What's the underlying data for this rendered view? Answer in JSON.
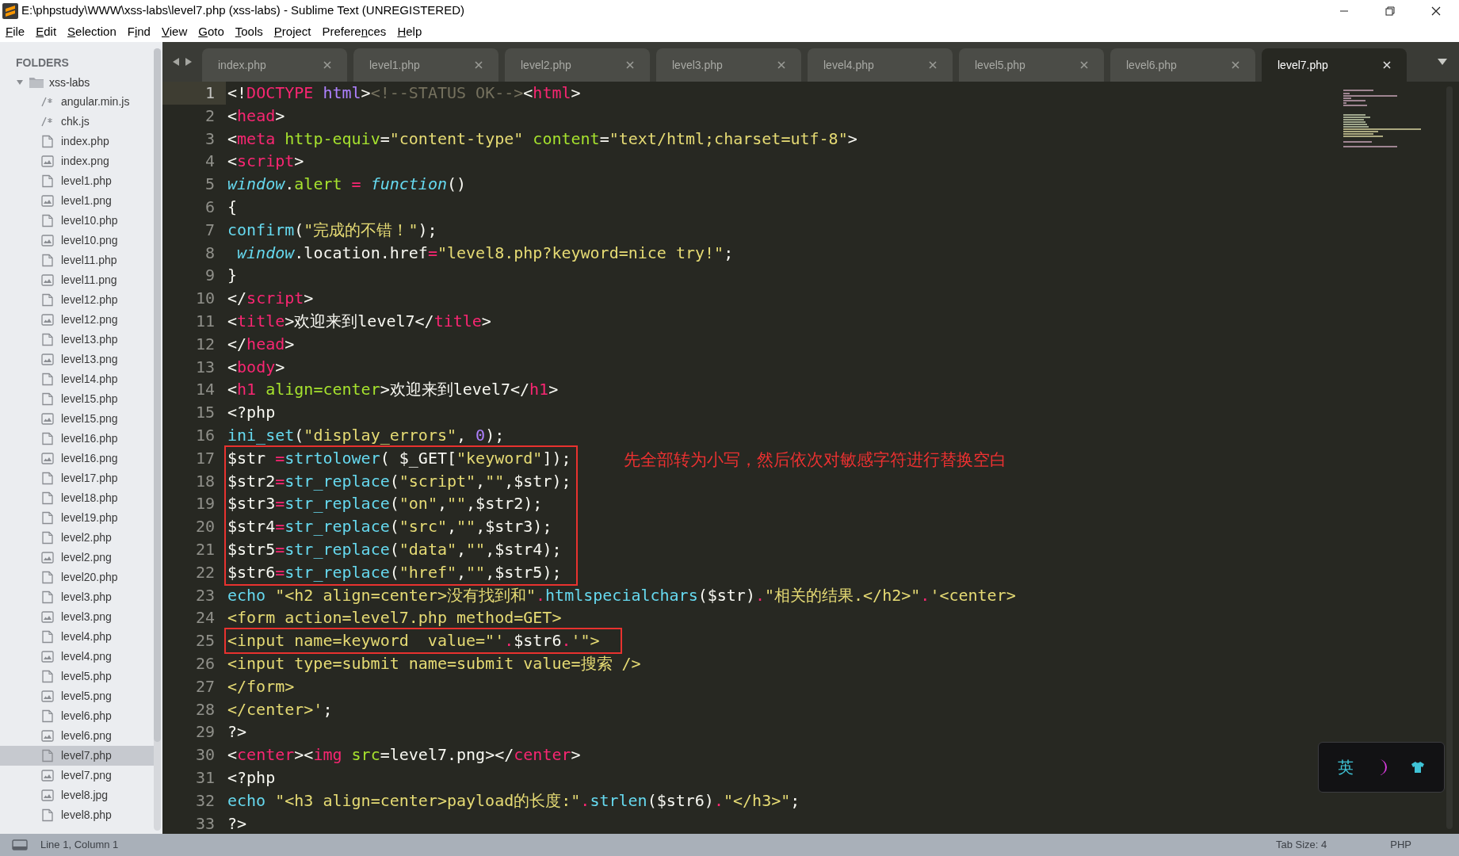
{
  "window": {
    "title": "E:\\phpstudy\\WWW\\xss-labs\\level7.php (xss-labs) - Sublime Text (UNREGISTERED)"
  },
  "menu": [
    {
      "accel": "F",
      "post": "ile"
    },
    {
      "accel": "E",
      "post": "dit"
    },
    {
      "accel": "S",
      "post": "election"
    },
    {
      "pre": "F",
      "accel": "i",
      "post": "nd"
    },
    {
      "accel": "V",
      "post": "iew"
    },
    {
      "accel": "G",
      "post": "oto"
    },
    {
      "accel": "T",
      "post": "ools"
    },
    {
      "accel": "P",
      "post": "roject"
    },
    {
      "pre": "Prefere",
      "accel": "n",
      "post": "ces"
    },
    {
      "accel": "H",
      "post": "elp"
    }
  ],
  "sidebar": {
    "header": "FOLDERS",
    "folder": {
      "name": "xss-labs",
      "expanded": true,
      "files": [
        {
          "name": "angular.min.js",
          "kind": "script",
          "selected": false
        },
        {
          "name": "chk.js",
          "kind": "script",
          "selected": false
        },
        {
          "name": "index.php",
          "kind": "file",
          "selected": false
        },
        {
          "name": "index.png",
          "kind": "image",
          "selected": false
        },
        {
          "name": "level1.php",
          "kind": "file",
          "selected": false
        },
        {
          "name": "level1.png",
          "kind": "image",
          "selected": false
        },
        {
          "name": "level10.php",
          "kind": "file",
          "selected": false
        },
        {
          "name": "level10.png",
          "kind": "image",
          "selected": false
        },
        {
          "name": "level11.php",
          "kind": "file",
          "selected": false
        },
        {
          "name": "level11.png",
          "kind": "image",
          "selected": false
        },
        {
          "name": "level12.php",
          "kind": "file",
          "selected": false
        },
        {
          "name": "level12.png",
          "kind": "image",
          "selected": false
        },
        {
          "name": "level13.php",
          "kind": "file",
          "selected": false
        },
        {
          "name": "level13.png",
          "kind": "image",
          "selected": false
        },
        {
          "name": "level14.php",
          "kind": "file",
          "selected": false
        },
        {
          "name": "level15.php",
          "kind": "file",
          "selected": false
        },
        {
          "name": "level15.png",
          "kind": "image",
          "selected": false
        },
        {
          "name": "level16.php",
          "kind": "file",
          "selected": false
        },
        {
          "name": "level16.png",
          "kind": "image",
          "selected": false
        },
        {
          "name": "level17.php",
          "kind": "file",
          "selected": false
        },
        {
          "name": "level18.php",
          "kind": "file",
          "selected": false
        },
        {
          "name": "level19.php",
          "kind": "file",
          "selected": false
        },
        {
          "name": "level2.php",
          "kind": "file",
          "selected": false
        },
        {
          "name": "level2.png",
          "kind": "image",
          "selected": false
        },
        {
          "name": "level20.php",
          "kind": "file",
          "selected": false
        },
        {
          "name": "level3.php",
          "kind": "file",
          "selected": false
        },
        {
          "name": "level3.png",
          "kind": "image",
          "selected": false
        },
        {
          "name": "level4.php",
          "kind": "file",
          "selected": false
        },
        {
          "name": "level4.png",
          "kind": "image",
          "selected": false
        },
        {
          "name": "level5.php",
          "kind": "file",
          "selected": false
        },
        {
          "name": "level5.png",
          "kind": "image",
          "selected": false
        },
        {
          "name": "level6.php",
          "kind": "file",
          "selected": false
        },
        {
          "name": "level6.png",
          "kind": "image",
          "selected": false
        },
        {
          "name": "level7.php",
          "kind": "file",
          "selected": true
        },
        {
          "name": "level7.png",
          "kind": "image",
          "selected": false
        },
        {
          "name": "level8.jpg",
          "kind": "image",
          "selected": false
        },
        {
          "name": "level8.php",
          "kind": "file",
          "selected": false
        }
      ]
    }
  },
  "tabs": [
    {
      "label": "index.php",
      "selected": false
    },
    {
      "label": "level1.php",
      "selected": false
    },
    {
      "label": "level2.php",
      "selected": false
    },
    {
      "label": "level3.php",
      "selected": false
    },
    {
      "label": "level4.php",
      "selected": false
    },
    {
      "label": "level5.php",
      "selected": false
    },
    {
      "label": "level6.php",
      "selected": false
    },
    {
      "label": "level7.php",
      "selected": true
    }
  ],
  "editor": {
    "lines": [
      {
        "number": "1",
        "current": true,
        "boxed": false,
        "tokens": [
          {
            "text": "<!",
            "kind": "plain"
          },
          {
            "text": "DOCTYPE",
            "kind": "tag"
          },
          {
            "text": " html",
            "kind": "number"
          },
          {
            "text": ">",
            "kind": "plain"
          },
          {
            "text": "<!--STATUS OK-->",
            "kind": "comment"
          },
          {
            "text": "<",
            "kind": "plain"
          },
          {
            "text": "html",
            "kind": "tag"
          },
          {
            "text": ">",
            "kind": "plain"
          }
        ]
      },
      {
        "number": "2",
        "current": false,
        "boxed": false,
        "tokens": [
          {
            "text": "<",
            "kind": "plain"
          },
          {
            "text": "head",
            "kind": "tag"
          },
          {
            "text": ">",
            "kind": "plain"
          }
        ]
      },
      {
        "number": "3",
        "current": false,
        "boxed": false,
        "tokens": [
          {
            "text": "<",
            "kind": "plain"
          },
          {
            "text": "meta",
            "kind": "tag"
          },
          {
            "text": " http-equiv",
            "kind": "attr"
          },
          {
            "text": "=",
            "kind": "plain"
          },
          {
            "text": "\"content-type\"",
            "kind": "string"
          },
          {
            "text": " content",
            "kind": "attr"
          },
          {
            "text": "=",
            "kind": "plain"
          },
          {
            "text": "\"text/html;charset=utf-8\"",
            "kind": "string"
          },
          {
            "text": ">",
            "kind": "plain"
          }
        ]
      },
      {
        "number": "4",
        "current": false,
        "boxed": false,
        "tokens": [
          {
            "text": "<",
            "kind": "plain"
          },
          {
            "text": "script",
            "kind": "tag"
          },
          {
            "text": ">",
            "kind": "plain"
          }
        ]
      },
      {
        "number": "5",
        "current": false,
        "boxed": false,
        "tokens": [
          {
            "text": "window",
            "kind": "storage"
          },
          {
            "text": ".",
            "kind": "plain"
          },
          {
            "text": "alert",
            "kind": "attr"
          },
          {
            "text": " =",
            "kind": "operator"
          },
          {
            "text": " function",
            "kind": "storage"
          },
          {
            "text": "()",
            "kind": "plain"
          }
        ]
      },
      {
        "number": "6",
        "current": false,
        "boxed": false,
        "tokens": [
          {
            "text": "{",
            "kind": "plain"
          }
        ]
      },
      {
        "number": "7",
        "current": false,
        "boxed": false,
        "tokens": [
          {
            "text": "confirm",
            "kind": "function"
          },
          {
            "text": "(",
            "kind": "plain"
          },
          {
            "text": "\"完成的不错！\"",
            "kind": "string"
          },
          {
            "text": ");",
            "kind": "plain"
          }
        ]
      },
      {
        "number": "8",
        "current": false,
        "boxed": false,
        "tokens": [
          {
            "text": " window",
            "kind": "storage"
          },
          {
            "text": ".location.href",
            "kind": "plain"
          },
          {
            "text": "=",
            "kind": "operator"
          },
          {
            "text": "\"level8.php?keyword=nice try!\"",
            "kind": "string"
          },
          {
            "text": ";",
            "kind": "plain"
          }
        ]
      },
      {
        "number": "9",
        "current": false,
        "boxed": false,
        "tokens": [
          {
            "text": "}",
            "kind": "plain"
          }
        ]
      },
      {
        "number": "10",
        "current": false,
        "boxed": false,
        "tokens": [
          {
            "text": "</",
            "kind": "plain"
          },
          {
            "text": "script",
            "kind": "tag"
          },
          {
            "text": ">",
            "kind": "plain"
          }
        ]
      },
      {
        "number": "11",
        "current": false,
        "boxed": false,
        "tokens": [
          {
            "text": "<",
            "kind": "plain"
          },
          {
            "text": "title",
            "kind": "tag"
          },
          {
            "text": ">欢迎来到level7</",
            "kind": "plain"
          },
          {
            "text": "title",
            "kind": "tag"
          },
          {
            "text": ">",
            "kind": "plain"
          }
        ]
      },
      {
        "number": "12",
        "current": false,
        "boxed": false,
        "tokens": [
          {
            "text": "</",
            "kind": "plain"
          },
          {
            "text": "head",
            "kind": "tag"
          },
          {
            "text": ">",
            "kind": "plain"
          }
        ]
      },
      {
        "number": "13",
        "current": false,
        "boxed": false,
        "tokens": [
          {
            "text": "<",
            "kind": "plain"
          },
          {
            "text": "body",
            "kind": "tag"
          },
          {
            "text": ">",
            "kind": "plain"
          }
        ]
      },
      {
        "number": "14",
        "current": false,
        "boxed": false,
        "tokens": [
          {
            "text": "<",
            "kind": "plain"
          },
          {
            "text": "h1",
            "kind": "tag"
          },
          {
            "text": " align=center",
            "kind": "attr"
          },
          {
            "text": ">欢迎来到level7</",
            "kind": "plain"
          },
          {
            "text": "h1",
            "kind": "tag"
          },
          {
            "text": ">",
            "kind": "plain"
          }
        ]
      },
      {
        "number": "15",
        "current": false,
        "boxed": false,
        "tokens": [
          {
            "text": "<?php",
            "kind": "plain"
          }
        ]
      },
      {
        "number": "16",
        "current": false,
        "boxed": false,
        "tokens": [
          {
            "text": "ini_set",
            "kind": "function"
          },
          {
            "text": "(",
            "kind": "plain"
          },
          {
            "text": "\"display_errors\"",
            "kind": "string"
          },
          {
            "text": ", ",
            "kind": "plain"
          },
          {
            "text": "0",
            "kind": "number"
          },
          {
            "text": ");",
            "kind": "plain"
          }
        ]
      },
      {
        "number": "17",
        "current": false,
        "boxed": true,
        "note": "先全部转为小写，然后依次对敏感字符进行替换空白",
        "tokens": [
          {
            "text": "$str ",
            "kind": "plain"
          },
          {
            "text": "=",
            "kind": "operator"
          },
          {
            "text": "strtolower",
            "kind": "function"
          },
          {
            "text": "( $_GET[",
            "kind": "plain"
          },
          {
            "text": "\"keyword\"",
            "kind": "string"
          },
          {
            "text": "]);",
            "kind": "plain"
          }
        ]
      },
      {
        "number": "18",
        "current": false,
        "boxed": true,
        "tokens": [
          {
            "text": "$str2",
            "kind": "plain"
          },
          {
            "text": "=",
            "kind": "operator"
          },
          {
            "text": "str_replace",
            "kind": "function"
          },
          {
            "text": "(",
            "kind": "plain"
          },
          {
            "text": "\"script\"",
            "kind": "string"
          },
          {
            "text": ",",
            "kind": "plain"
          },
          {
            "text": "\"\"",
            "kind": "string"
          },
          {
            "text": ",$str);",
            "kind": "plain"
          }
        ]
      },
      {
        "number": "19",
        "current": false,
        "boxed": true,
        "tokens": [
          {
            "text": "$str3",
            "kind": "plain"
          },
          {
            "text": "=",
            "kind": "operator"
          },
          {
            "text": "str_replace",
            "kind": "function"
          },
          {
            "text": "(",
            "kind": "plain"
          },
          {
            "text": "\"on\"",
            "kind": "string"
          },
          {
            "text": ",",
            "kind": "plain"
          },
          {
            "text": "\"\"",
            "kind": "string"
          },
          {
            "text": ",$str2);",
            "kind": "plain"
          }
        ]
      },
      {
        "number": "20",
        "current": false,
        "boxed": true,
        "tokens": [
          {
            "text": "$str4",
            "kind": "plain"
          },
          {
            "text": "=",
            "kind": "operator"
          },
          {
            "text": "str_replace",
            "kind": "function"
          },
          {
            "text": "(",
            "kind": "plain"
          },
          {
            "text": "\"src\"",
            "kind": "string"
          },
          {
            "text": ",",
            "kind": "plain"
          },
          {
            "text": "\"\"",
            "kind": "string"
          },
          {
            "text": ",$str3);",
            "kind": "plain"
          }
        ]
      },
      {
        "number": "21",
        "current": false,
        "boxed": true,
        "tokens": [
          {
            "text": "$str5",
            "kind": "plain"
          },
          {
            "text": "=",
            "kind": "operator"
          },
          {
            "text": "str_replace",
            "kind": "function"
          },
          {
            "text": "(",
            "kind": "plain"
          },
          {
            "text": "\"data\"",
            "kind": "string"
          },
          {
            "text": ",",
            "kind": "plain"
          },
          {
            "text": "\"\"",
            "kind": "string"
          },
          {
            "text": ",$str4);",
            "kind": "plain"
          }
        ]
      },
      {
        "number": "22",
        "current": false,
        "boxed": true,
        "tokens": [
          {
            "text": "$str6",
            "kind": "plain"
          },
          {
            "text": "=",
            "kind": "operator"
          },
          {
            "text": "str_replace",
            "kind": "function"
          },
          {
            "text": "(",
            "kind": "plain"
          },
          {
            "text": "\"href\"",
            "kind": "string"
          },
          {
            "text": ",",
            "kind": "plain"
          },
          {
            "text": "\"\"",
            "kind": "string"
          },
          {
            "text": ",$str5);",
            "kind": "plain"
          }
        ]
      },
      {
        "number": "23",
        "current": false,
        "boxed": false,
        "tokens": [
          {
            "text": "echo ",
            "kind": "function"
          },
          {
            "text": "\"<h2 align=center>没有找到和\"",
            "kind": "string"
          },
          {
            "text": ".",
            "kind": "operator"
          },
          {
            "text": "htmlspecialchars",
            "kind": "function"
          },
          {
            "text": "($str)",
            "kind": "plain"
          },
          {
            "text": ".",
            "kind": "operator"
          },
          {
            "text": "\"相关的结果.</h2>\"",
            "kind": "string"
          },
          {
            "text": ".",
            "kind": "operator"
          },
          {
            "text": "'<center>",
            "kind": "string"
          }
        ]
      },
      {
        "number": "24",
        "current": false,
        "boxed": false,
        "tokens": [
          {
            "text": "<form action=level7.php method=GET>",
            "kind": "string"
          }
        ]
      },
      {
        "number": "25",
        "current": false,
        "boxed": true,
        "tokens": [
          {
            "text": "<input name=keyword  value=\"'",
            "kind": "string"
          },
          {
            "text": ".",
            "kind": "operator"
          },
          {
            "text": "$str6",
            "kind": "plain"
          },
          {
            "text": ".",
            "kind": "operator"
          },
          {
            "text": "'\">",
            "kind": "string"
          }
        ]
      },
      {
        "number": "26",
        "current": false,
        "boxed": false,
        "tokens": [
          {
            "text": "<input type=submit name=submit value=搜索 />",
            "kind": "string"
          }
        ]
      },
      {
        "number": "27",
        "current": false,
        "boxed": false,
        "tokens": [
          {
            "text": "</form>",
            "kind": "string"
          }
        ]
      },
      {
        "number": "28",
        "current": false,
        "boxed": false,
        "tokens": [
          {
            "text": "</center>'",
            "kind": "string"
          },
          {
            "text": ";",
            "kind": "plain"
          }
        ]
      },
      {
        "number": "29",
        "current": false,
        "boxed": false,
        "tokens": [
          {
            "text": "?>",
            "kind": "plain"
          }
        ]
      },
      {
        "number": "30",
        "current": false,
        "boxed": false,
        "tokens": [
          {
            "text": "<",
            "kind": "plain"
          },
          {
            "text": "center",
            "kind": "tag"
          },
          {
            "text": "><",
            "kind": "plain"
          },
          {
            "text": "img",
            "kind": "tag"
          },
          {
            "text": " src",
            "kind": "attr"
          },
          {
            "text": "=level7.png></",
            "kind": "plain"
          },
          {
            "text": "center",
            "kind": "tag"
          },
          {
            "text": ">",
            "kind": "plain"
          }
        ]
      },
      {
        "number": "31",
        "current": false,
        "boxed": false,
        "tokens": [
          {
            "text": "<?php",
            "kind": "plain"
          }
        ]
      },
      {
        "number": "32",
        "current": false,
        "boxed": false,
        "tokens": [
          {
            "text": "echo ",
            "kind": "function"
          },
          {
            "text": "\"<h3 align=center>payload的长度:\"",
            "kind": "string"
          },
          {
            "text": ".",
            "kind": "operator"
          },
          {
            "text": "strlen",
            "kind": "function"
          },
          {
            "text": "($str6)",
            "kind": "plain"
          },
          {
            "text": ".",
            "kind": "operator"
          },
          {
            "text": "\"</h3>\"",
            "kind": "string"
          },
          {
            "text": ";",
            "kind": "plain"
          }
        ]
      },
      {
        "number": "33",
        "current": false,
        "boxed": false,
        "tokens": [
          {
            "text": "?>",
            "kind": "plain"
          }
        ]
      }
    ]
  },
  "ime_widget": {
    "language": "英"
  },
  "status_bar": {
    "position": "Line 1, Column 1",
    "tab_size": "Tab Size: 4",
    "syntax": "PHP"
  }
}
